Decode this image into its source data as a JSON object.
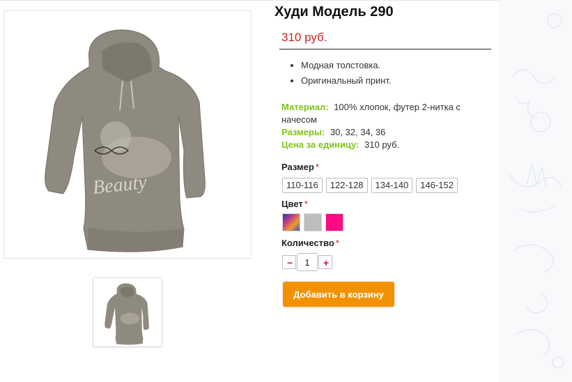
{
  "product": {
    "title": "Худи Модель 290",
    "price": "310 руб.",
    "image_alt": "hoodie with Beauty print",
    "print_text": "Beauty"
  },
  "features": [
    "Модная толстовка.",
    "Оригинальный принт."
  ],
  "specs": {
    "material_label": "Материал:",
    "material_value": "100% хлопок, футер 2-нитка с начесом",
    "sizes_label": "Размеры:",
    "sizes_value": "30, 32, 34, 36",
    "unit_price_label": "Цена за единицу:",
    "unit_price_value": "310 руб."
  },
  "options": {
    "size_label": "Размер",
    "size_options": [
      "110-116",
      "122-128",
      "134-140",
      "146-152"
    ],
    "color_label": "Цвет",
    "colors": [
      {
        "name": "multicolor",
        "hex": "#6a4aa0"
      },
      {
        "name": "grey",
        "hex": "#bdbdbd"
      },
      {
        "name": "pink",
        "hex": "#ff0a84"
      }
    ],
    "quantity_label": "Количество",
    "quantity": "1",
    "required_mark": "*"
  },
  "buttons": {
    "minus": "−",
    "plus": "+",
    "add_to_cart": "Добавить в корзину"
  },
  "colors": {
    "price": "#d0231e",
    "spec_label": "#7fc31c",
    "cart_button": "#f39200",
    "hoodie": "#8f8a7f"
  }
}
